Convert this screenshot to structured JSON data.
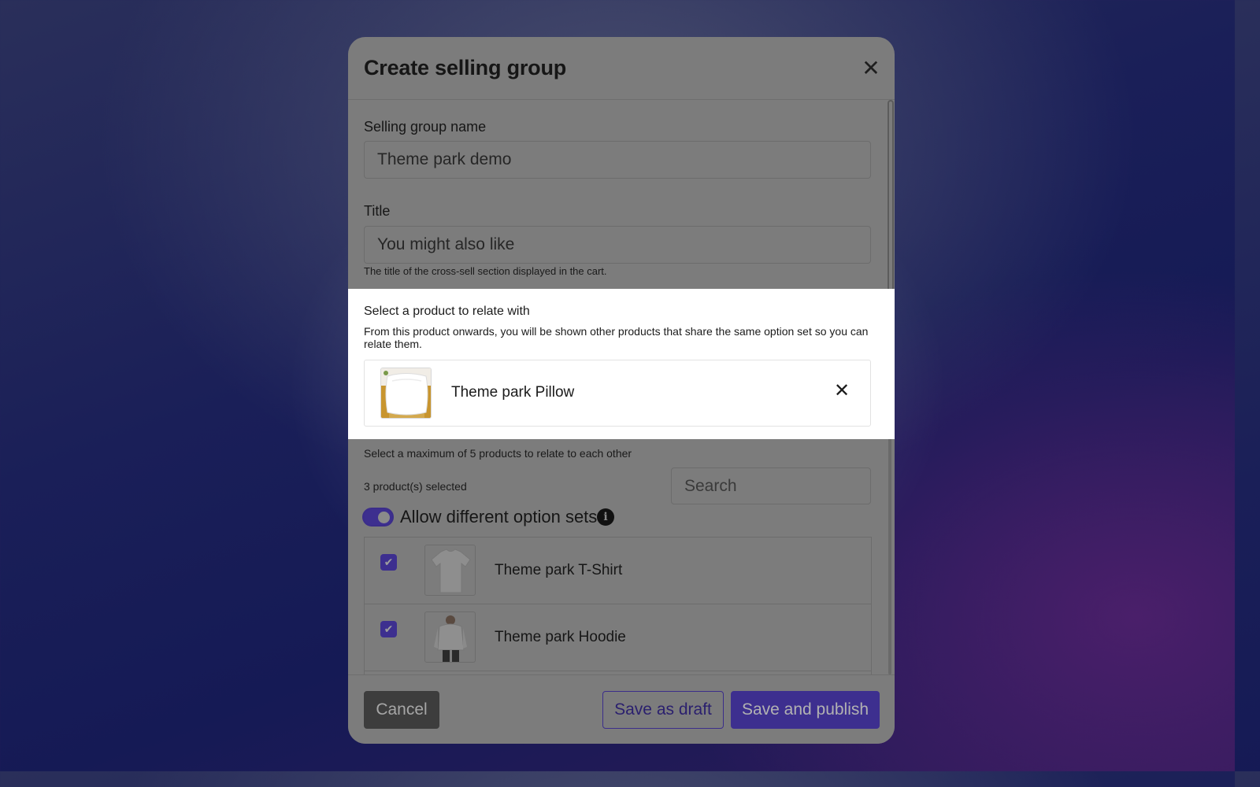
{
  "modal": {
    "title": "Create selling group",
    "close_icon": "close-icon"
  },
  "form": {
    "group_name_label": "Selling group name",
    "group_name_value": "Theme park demo",
    "title_label": "Title",
    "title_value": "You might also like",
    "title_help": "The title of the cross-sell section displayed in the cart."
  },
  "relate": {
    "label": "Select a product to relate with",
    "description": "From this product onwards, you will be shown other products that share the same option set so you can relate them.",
    "selected_product": "Theme park Pillow",
    "remove_icon": "close-icon"
  },
  "products": {
    "max_text": "Select a maximum of 5 products to relate to each other",
    "count_text": "3 product(s) selected",
    "search_placeholder": "Search",
    "toggle_label": "Allow different option sets",
    "toggle_on": true,
    "info_icon": "info-icon",
    "items": [
      {
        "name": "Theme park T-Shirt",
        "checked": true,
        "thumb_icon": "tshirt-icon"
      },
      {
        "name": "Theme park Hoodie",
        "checked": true,
        "thumb_icon": "hoodie-icon"
      }
    ]
  },
  "footer": {
    "cancel_label": "Cancel",
    "draft_label": "Save as draft",
    "publish_label": "Save and publish"
  },
  "colors": {
    "accent": "#3d2f8f",
    "overlay": "#7c7c7c",
    "highlight": "#ffffff"
  }
}
